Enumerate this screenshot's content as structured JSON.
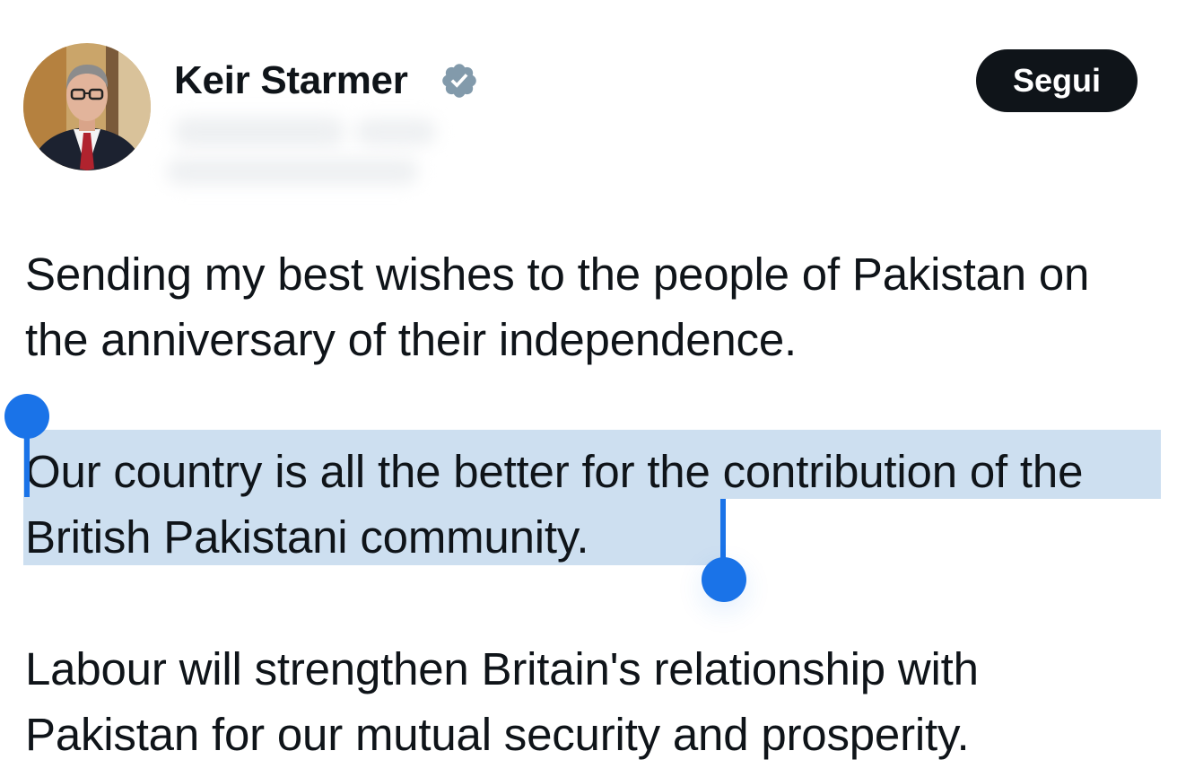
{
  "author": {
    "display_name": "Keir Starmer",
    "verified_icon": "verified-badge-icon",
    "avatar_icon": "profile-photo"
  },
  "follow_label": "Segui",
  "tweet": {
    "paragraphs": [
      "Sending my best wishes to the people of Pakistan on the anniversary of their independence.",
      "Our country is all the better for the contribution of the British Pakistani community.",
      "Labour will strengthen Britain's relationship with Pakistan for our mutual security and prosperity."
    ]
  },
  "colors": {
    "text": "#0f1419",
    "follow_button_bg": "#0f1419",
    "follow_button_text": "#ffffff",
    "selection_highlight": "#cddff0",
    "selection_handle": "#1a73e8",
    "verified_badge": "#829aab"
  }
}
